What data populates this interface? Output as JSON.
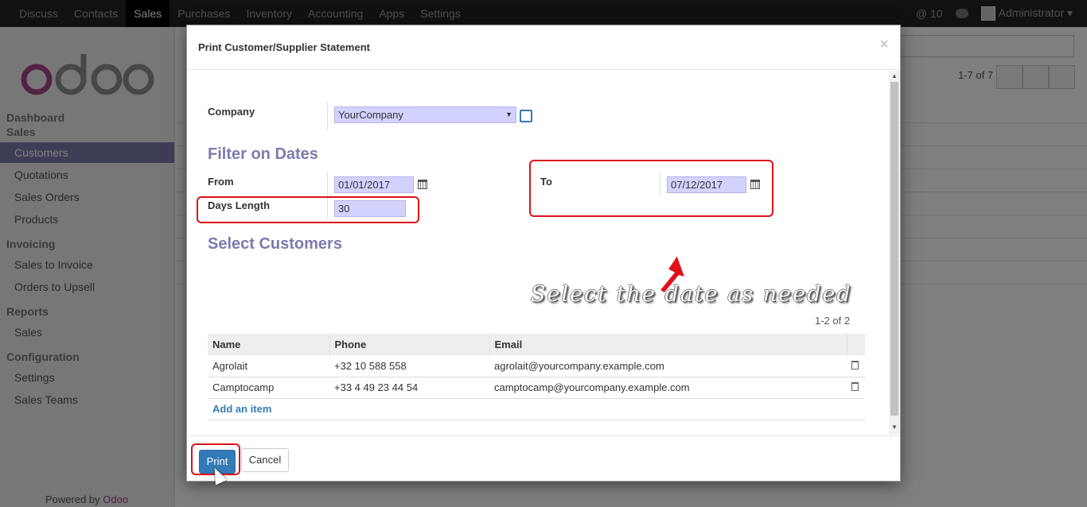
{
  "topbar": {
    "menu": [
      "Discuss",
      "Contacts",
      "Sales",
      "Purchases",
      "Inventory",
      "Accounting",
      "Apps",
      "Settings"
    ],
    "active": "Sales",
    "mentions": "@ 10",
    "user": "Administrator"
  },
  "sidebar": {
    "logo": "odoo",
    "sections": [
      {
        "title": "Dashboard",
        "items": []
      },
      {
        "title": "Sales",
        "items": [
          "Customers",
          "Quotations",
          "Sales Orders",
          "Products"
        ]
      },
      {
        "title": "Invoicing",
        "items": [
          "Sales to Invoice",
          "Orders to Upsell"
        ]
      },
      {
        "title": "Reports",
        "items": [
          "Sales"
        ]
      },
      {
        "title": "Configuration",
        "items": [
          "Settings",
          "Sales Teams"
        ]
      }
    ],
    "active_item": "Customers",
    "powered_prefix": "Powered by",
    "powered_brand": "Odoo"
  },
  "background": {
    "pager": "1-7 of 7"
  },
  "modal": {
    "title": "Print Customer/Supplier Statement",
    "close": "×",
    "company_label": "Company",
    "company_value": "YourCompany",
    "filter_heading": "Filter on Dates",
    "from_label": "From",
    "from_value": "01/01/2017",
    "to_label": "To",
    "to_value": "07/12/2017",
    "days_label": "Days Length",
    "days_value": "30",
    "customers_heading": "Select Customers",
    "pager": "1-2 of 2",
    "columns": [
      "Name",
      "Phone",
      "Email"
    ],
    "rows": [
      {
        "name": "Agrolait",
        "phone": "+32 10 588 558",
        "email": "agrolait@yourcompany.example.com"
      },
      {
        "name": "Camptocamp",
        "phone": "+33 4 49 23 44 54",
        "email": "camptocamp@yourcompany.example.com"
      }
    ],
    "add_item": "Add an item",
    "print_label": "Print",
    "cancel_label": "Cancel"
  },
  "annotation": "Select the date as needed",
  "colors": {
    "accent": "#7c7bad",
    "highlight": "#e0101a",
    "primary": "#337ab7"
  }
}
